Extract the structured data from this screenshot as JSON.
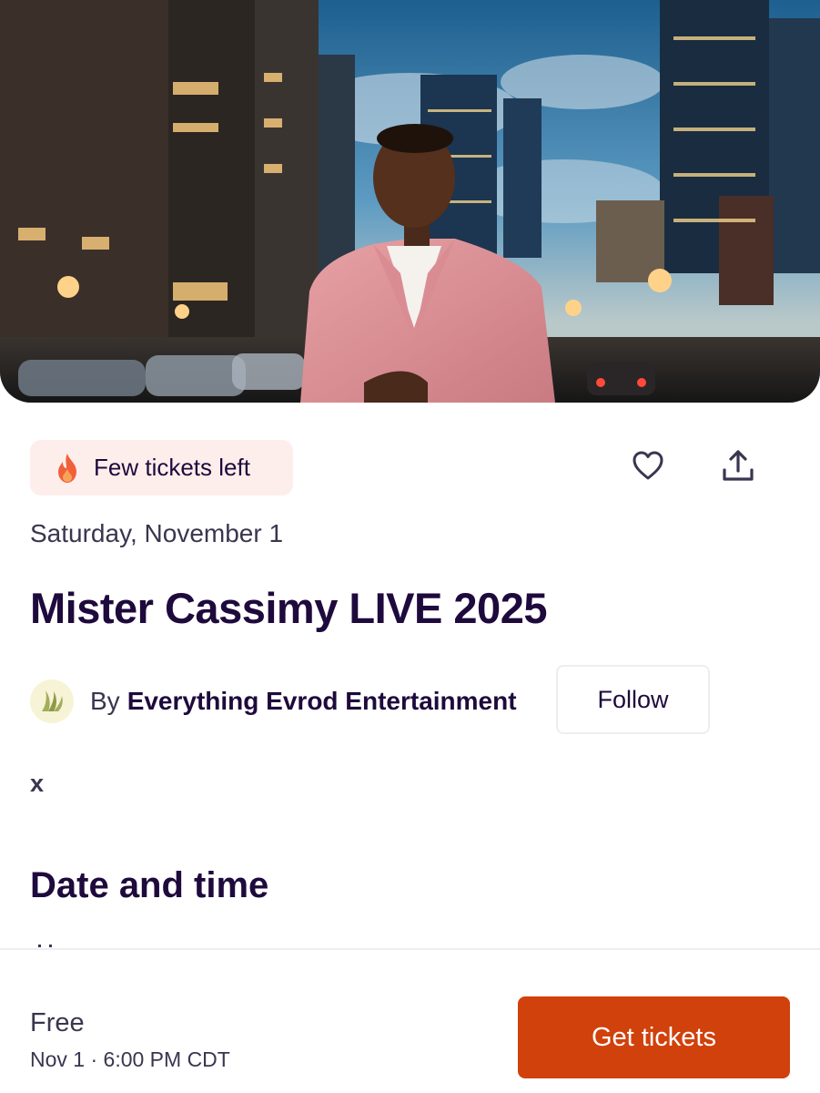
{
  "hero": {
    "image_alt": "Man in pink suit standing on a city street at dusk"
  },
  "badge": {
    "icon": "fire-icon",
    "text": "Few tickets left"
  },
  "actions": {
    "like_icon": "heart-icon",
    "share_icon": "share-icon"
  },
  "event": {
    "date": "Saturday, November 1",
    "title": "Mister Cassimy LIVE 2025"
  },
  "organizer": {
    "by_label": "By",
    "name": "Everything Evrod Entertainment",
    "follow_label": "Follow"
  },
  "summary": {
    "text": "x"
  },
  "sections": {
    "date_and_time": "Date and time"
  },
  "footer": {
    "price": "Free",
    "datetime": "Nov 1 · 6:00 PM CDT",
    "cta_label": "Get tickets"
  },
  "colors": {
    "brand_orange": "#d1410c",
    "text_dark": "#1e0a3c",
    "badge_bg": "#fdeeec"
  }
}
